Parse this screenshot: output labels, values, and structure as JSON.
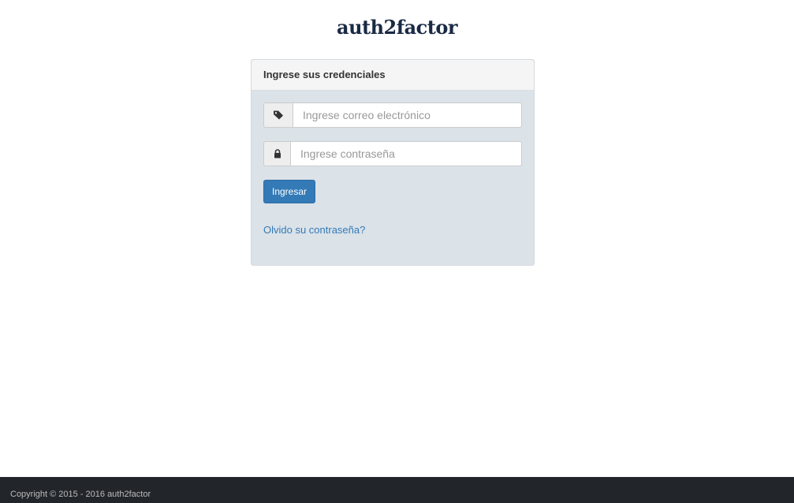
{
  "brand": {
    "logo_text": "auth2factor"
  },
  "login_panel": {
    "heading": "Ingrese sus credenciales",
    "email_field": {
      "placeholder": "Ingrese correo electrónico",
      "icon": "tag-icon"
    },
    "password_field": {
      "placeholder": "Ingrese contraseña",
      "icon": "lock-icon"
    },
    "submit_label": "Ingresar",
    "forgot_link": "Olvido su contraseña?"
  },
  "footer": {
    "copyright": "Copyright © 2015 - 2016 auth2factor"
  },
  "colors": {
    "accent": "#337ab7",
    "panel_body": "#dbe2e8",
    "footer_bg": "#22262b",
    "logo": "#1a2a44"
  }
}
